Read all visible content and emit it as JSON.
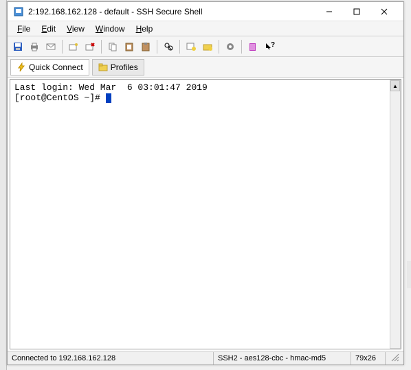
{
  "title": "2:192.168.162.128 - default - SSH Secure Shell",
  "menus": {
    "file": "File",
    "edit": "Edit",
    "view": "View",
    "window": "Window",
    "help": "Help"
  },
  "sec_toolbar": {
    "quick_connect": "Quick Connect",
    "profiles": "Profiles"
  },
  "terminal": {
    "last_login": "Last login: Wed Mar  6 03:01:47 2019",
    "prompt": "[root@CentOS ~]# "
  },
  "status": {
    "connected": "Connected to 192.168.162.128",
    "protocol": "SSH2 - aes128-cbc - hmac-md5",
    "dimensions": "79x26"
  }
}
